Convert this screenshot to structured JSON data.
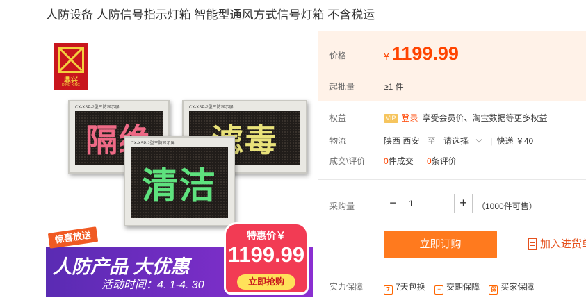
{
  "product": {
    "title": "人防设备 人防信号指示灯箱 智能型通风方式信号灯箱 不含税运"
  },
  "image": {
    "logo_cn": "鼎兴",
    "logo_en": "DING XING",
    "panels": [
      {
        "caption": "CX-XSP-2型三防显示屏",
        "text": "隔绝"
      },
      {
        "caption": "CX-XSP-2型三防显示屏",
        "text": "滤毒"
      },
      {
        "caption": "CX-XSP-2型三防显示屏",
        "text": "清洁"
      }
    ],
    "promo_tag": "惊喜放送",
    "promo_headline": "人防产品  大优惠",
    "promo_time": "活动时间：4. 1-4. 30",
    "badge_label": "特惠价￥",
    "badge_price": "1199.99",
    "badge_button": "立即抢购"
  },
  "price_box": {
    "price_label": "价格",
    "currency": "¥",
    "price": "1199.99",
    "moq_label": "起批量",
    "moq_value": "≥1 件"
  },
  "rights": {
    "label": "权益",
    "vip": "VIP",
    "login": "登录",
    "text": "享受会员价、淘宝数据等更多权益"
  },
  "logistics": {
    "label": "物流",
    "origin": "陕西 西安",
    "to": "至",
    "dest_placeholder": "请选择",
    "shipping": "快递 ￥40"
  },
  "sales": {
    "label": "成交\\评价",
    "orders_count": "0",
    "orders_text": "件成交",
    "reviews_count": "0",
    "reviews_text": "条评价"
  },
  "quantity": {
    "label": "采购量",
    "minus": "−",
    "value": "1",
    "plus": "+",
    "stock": "（1000件可售）"
  },
  "actions": {
    "buy": "立即订购",
    "cart": "加入进货单"
  },
  "guarantee": {
    "label": "实力保障",
    "items": [
      {
        "icon": "7",
        "text": "7天包换"
      },
      {
        "icon": "≡",
        "text": "交期保障"
      },
      {
        "icon": "保",
        "text": "买家保障"
      }
    ]
  },
  "colors": {
    "price": "#ff4400",
    "buy_button": "#ff7a1e",
    "price_box_bg": "#fff2e8"
  }
}
